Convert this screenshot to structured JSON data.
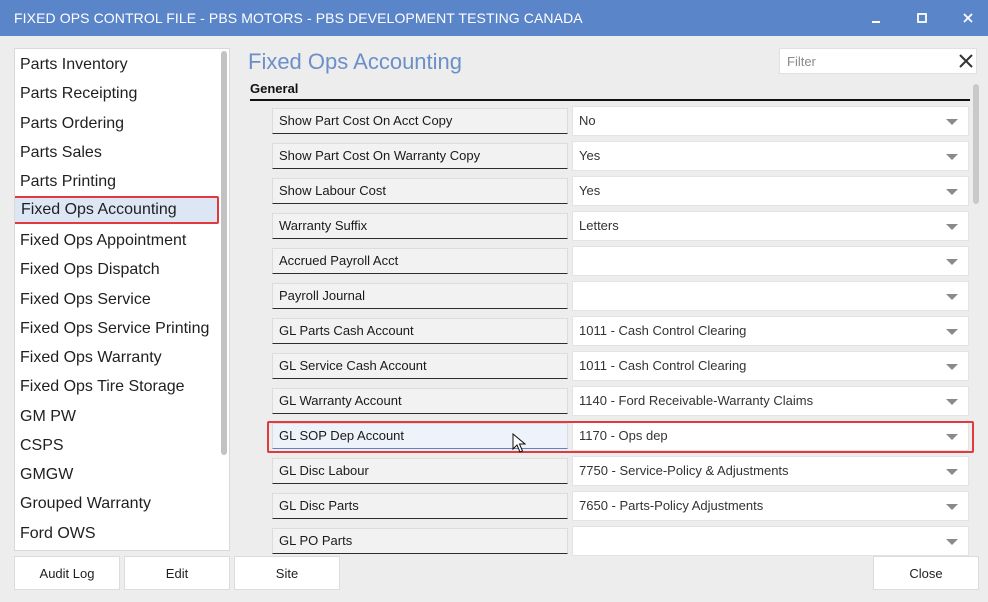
{
  "window": {
    "title": "FIXED OPS CONTROL FILE - PBS MOTORS - PBS DEVELOPMENT TESTING CANADA"
  },
  "sidebar": {
    "items": [
      {
        "label": "Parts Inventory"
      },
      {
        "label": "Parts Receipting"
      },
      {
        "label": "Parts Ordering"
      },
      {
        "label": "Parts Sales"
      },
      {
        "label": "Parts Printing"
      },
      {
        "label": "Fixed Ops Accounting",
        "selected": true
      },
      {
        "label": "Fixed Ops Appointment"
      },
      {
        "label": "Fixed Ops Dispatch"
      },
      {
        "label": "Fixed Ops Service"
      },
      {
        "label": "Fixed Ops Service Printing"
      },
      {
        "label": "Fixed Ops Warranty"
      },
      {
        "label": "Fixed Ops Tire Storage"
      },
      {
        "label": "GM PW"
      },
      {
        "label": "CSPS"
      },
      {
        "label": "GMGW"
      },
      {
        "label": "Grouped Warranty"
      },
      {
        "label": "Ford OWS"
      }
    ]
  },
  "main": {
    "heading": "Fixed Ops Accounting",
    "filter_placeholder": "Filter",
    "section": "General",
    "fields": [
      {
        "label": "Show Part Cost On Acct Copy",
        "value": "No"
      },
      {
        "label": "Show Part Cost On Warranty Copy",
        "value": "Yes"
      },
      {
        "label": "Show Labour Cost",
        "value": "Yes"
      },
      {
        "label": "Warranty Suffix",
        "value": "Letters"
      },
      {
        "label": "Accrued Payroll Acct",
        "value": ""
      },
      {
        "label": "Payroll Journal",
        "value": ""
      },
      {
        "label": "GL Parts Cash Account",
        "value": "1011 - Cash Control Clearing"
      },
      {
        "label": "GL Service Cash Account",
        "value": "1011 - Cash Control Clearing"
      },
      {
        "label": "GL Warranty Account",
        "value": "1140 - Ford Receivable-Warranty Claims"
      },
      {
        "label": "GL SOP Dep Account",
        "value": "1170 - Ops dep",
        "highlighted": true
      },
      {
        "label": "GL Disc Labour",
        "value": "7750 - Service-Policy & Adjustments"
      },
      {
        "label": "GL Disc Parts",
        "value": "7650 - Parts-Policy Adjustments"
      },
      {
        "label": "GL PO Parts",
        "value": ""
      }
    ]
  },
  "footer": {
    "audit_log": "Audit Log",
    "edit": "Edit",
    "site": "Site",
    "close": "Close"
  },
  "colors": {
    "titlebar": "#5b85c9",
    "heading": "#6b8fc9",
    "highlight_outline": "#e0393e"
  }
}
